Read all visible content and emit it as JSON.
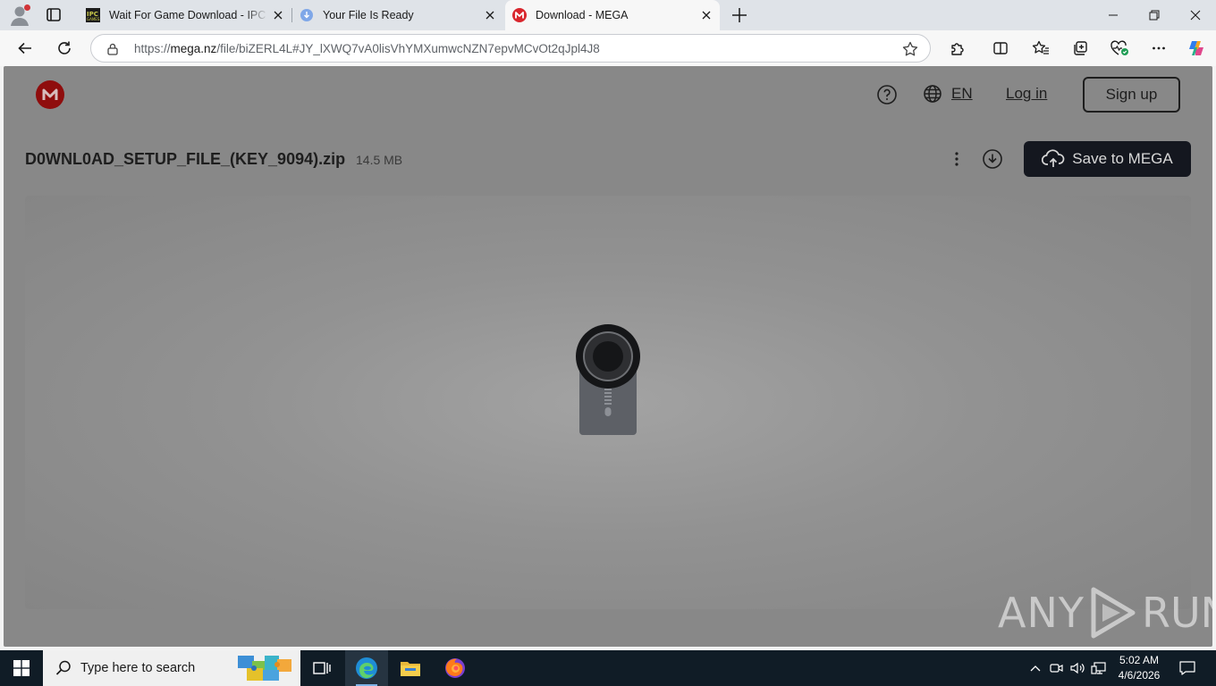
{
  "browser": {
    "tabs": [
      {
        "title": "Wait For Game Download - IPC Games",
        "favicon": "ipc-games-favicon",
        "active": false
      },
      {
        "title": "Your File Is Ready",
        "favicon": "download-favicon",
        "active": false
      },
      {
        "title": "Download - MEGA",
        "favicon": "mega-favicon",
        "active": true
      }
    ],
    "address": {
      "prefix": "https://",
      "domain": "mega.nz",
      "path": "/file/biZERL4L#JY_lXWQ7vA0lisVhYMXumwcNZN7epvMCvOt2qJpl4J8"
    }
  },
  "page": {
    "header": {
      "language": "EN",
      "login_label": "Log in",
      "signup_label": "Sign up"
    },
    "file": {
      "name": "D0WNL0AD_SETUP_FILE_(KEY_9094).zip",
      "size": "14.5 MB"
    },
    "save_label": "Save to MEGA",
    "watermark_left": "ANY",
    "watermark_right": "RUN"
  },
  "taskbar": {
    "search_placeholder": "Type here to search",
    "apps": [
      "task-view-icon",
      "edge-icon",
      "file-explorer-icon",
      "firefox-icon"
    ],
    "time": "5:02 AM",
    "date": "4/6/2026"
  },
  "colors": {
    "mega_red": "#d9272e",
    "save_button": "#14171f",
    "page_overlay": "#888888",
    "taskbar": "#101c26"
  }
}
